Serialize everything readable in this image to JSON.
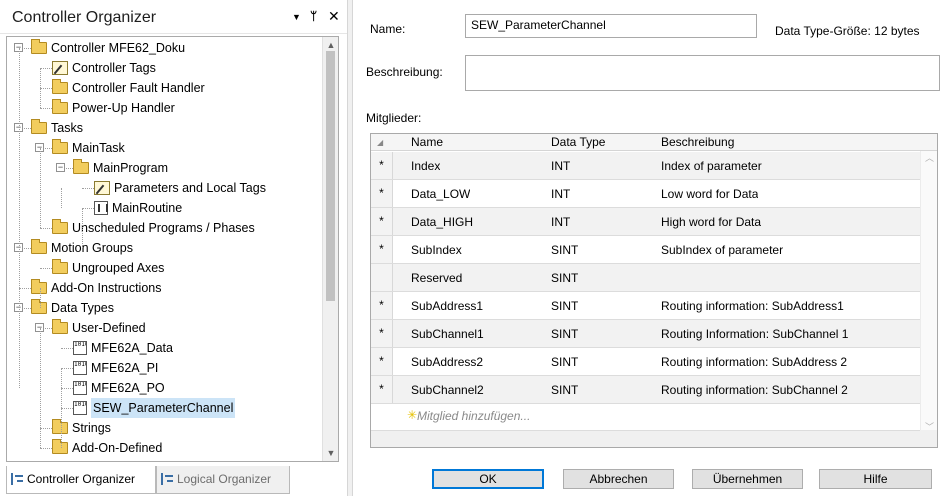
{
  "left_pane": {
    "title": "Controller Organizer",
    "header_buttons": {
      "dropdown": "▼",
      "pin": "ᛘ",
      "close": "✕"
    },
    "tree": [
      {
        "label": "Controller MFE62_Doku",
        "icon": "folder-icon",
        "level": 0,
        "expander": "−"
      },
      {
        "label": "Controller Tags",
        "icon": "tags-icon",
        "level": 1
      },
      {
        "label": "Controller Fault Handler",
        "icon": "folder-icon",
        "level": 1
      },
      {
        "label": "Power-Up Handler",
        "icon": "folder-icon",
        "level": 1
      },
      {
        "label": "Tasks",
        "icon": "folder-icon",
        "level": 0,
        "expander": "−"
      },
      {
        "label": "MainTask",
        "icon": "task-icon",
        "level": 1,
        "expander": "−"
      },
      {
        "label": "MainProgram",
        "icon": "program-icon",
        "level": 2,
        "expander": "−"
      },
      {
        "label": "Parameters and Local Tags",
        "icon": "tags-icon",
        "level": 3
      },
      {
        "label": "MainRoutine",
        "icon": "routine-icon",
        "level": 3
      },
      {
        "label": "Unscheduled Programs / Phases",
        "icon": "folder-icon",
        "level": 1
      },
      {
        "label": "Motion Groups",
        "icon": "folder-icon",
        "level": 0,
        "expander": "−"
      },
      {
        "label": "Ungrouped Axes",
        "icon": "folder-icon",
        "level": 1
      },
      {
        "label": "Add-On Instructions",
        "icon": "folder-icon",
        "level": 0
      },
      {
        "label": "Data Types",
        "icon": "folder-icon",
        "level": 0,
        "expander": "−"
      },
      {
        "label": "User-Defined",
        "icon": "folder-icon",
        "level": 1,
        "expander": "−"
      },
      {
        "label": "MFE62A_Data",
        "icon": "udt-icon",
        "level": 2
      },
      {
        "label": "MFE62A_PI",
        "icon": "udt-icon",
        "level": 2
      },
      {
        "label": "MFE62A_PO",
        "icon": "udt-icon",
        "level": 2
      },
      {
        "label": "SEW_ParameterChannel",
        "icon": "udt-icon",
        "level": 2,
        "selected": true
      },
      {
        "label": "Strings",
        "icon": "folder-icon",
        "level": 1
      },
      {
        "label": "Add-On-Defined",
        "icon": "folder-icon",
        "level": 1
      }
    ],
    "scroll_up": "▲",
    "scroll_down": "▼",
    "tabs": [
      {
        "label": "Controller Organizer",
        "active": true
      },
      {
        "label": "Logical Organizer",
        "active": false
      }
    ]
  },
  "editor": {
    "name_label": "Name:",
    "name_value": "SEW_ParameterChannel",
    "size_label": "Data Type-Größe: 12 bytes",
    "description_label": "Beschreibung:",
    "description_value": "",
    "members_label": "Mitglieder:",
    "columns": [
      "Name",
      "Data Type",
      "Beschreibung"
    ],
    "rows": [
      {
        "marker": "*",
        "name": "Index",
        "type": "INT",
        "desc": "Index of parameter"
      },
      {
        "marker": "*",
        "name": "Data_LOW",
        "type": "INT",
        "desc": "Low word for Data"
      },
      {
        "marker": "*",
        "name": "Data_HIGH",
        "type": "INT",
        "desc": "High word for Data"
      },
      {
        "marker": "*",
        "name": "SubIndex",
        "type": "SINT",
        "desc": "SubIndex of parameter"
      },
      {
        "marker": "",
        "name": "Reserved",
        "type": "SINT",
        "desc": ""
      },
      {
        "marker": "*",
        "name": "SubAddress1",
        "type": "SINT",
        "desc": "Routing information: SubAddress1"
      },
      {
        "marker": "*",
        "name": "SubChannel1",
        "type": "SINT",
        "desc": "Routing Information: SubChannel 1"
      },
      {
        "marker": "*",
        "name": "SubAddress2",
        "type": "SINT",
        "desc": "Routing information: SubAddress 2"
      },
      {
        "marker": "*",
        "name": "SubChannel2",
        "type": "SINT",
        "desc": "Routing information: SubChannel 2"
      }
    ],
    "add_member_star": "✳",
    "add_member_text": "Mitglied hinzufügen...",
    "buttons": {
      "ok": "OK",
      "cancel": "Abbrechen",
      "apply": "Übernehmen",
      "help": "Hilfe"
    }
  },
  "colors": {
    "selection": "#cce4f7",
    "folder": "#f2cd5e",
    "default_button_border": "#0078d7"
  }
}
